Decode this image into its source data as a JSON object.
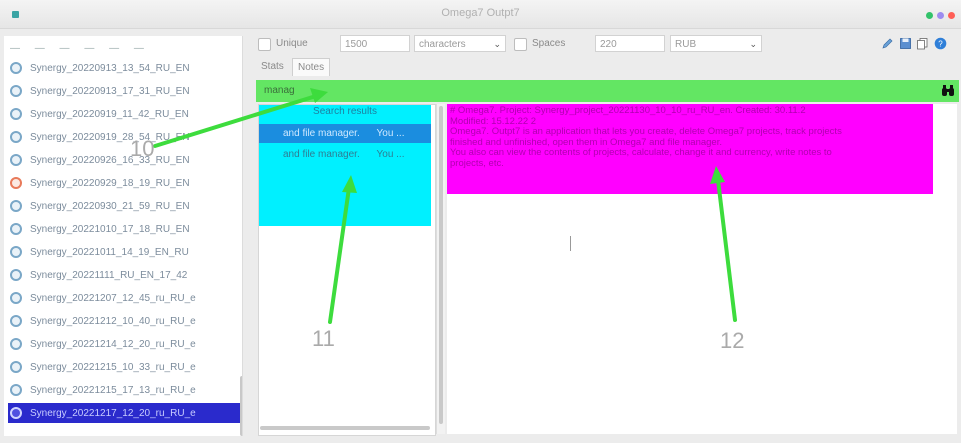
{
  "window": {
    "title": "Omega7 Outpt7",
    "colors": {
      "close": "#ff5f57",
      "minimize": "#9d8cf0",
      "zoom": "#32c26a"
    }
  },
  "sidebar": {
    "items": [
      {
        "label": "Synergy_20220913_13_54_RU_EN",
        "icon": "document-icon"
      },
      {
        "label": "Synergy_20220913_17_31_RU_EN",
        "icon": "document-icon"
      },
      {
        "label": "Synergy_20220919_11_42_RU_EN",
        "icon": "document-icon"
      },
      {
        "label": "Synergy_20220919_28_54_RU_EN",
        "icon": "document-icon"
      },
      {
        "label": "Synergy_20220926_16_33_RU_EN",
        "icon": "document-icon"
      },
      {
        "label": "Synergy_20220929_18_19_RU_EN",
        "icon": "document-red-icon"
      },
      {
        "label": "Synergy_20220930_21_59_RU_EN",
        "icon": "document-icon"
      },
      {
        "label": "Synergy_20221010_17_18_RU_EN",
        "icon": "document-icon"
      },
      {
        "label": "Synergy_20221011_14_19_EN_RU",
        "icon": "document-icon"
      },
      {
        "label": "Synergy_20221111_RU_EN_17_42",
        "icon": "document-icon"
      },
      {
        "label": "Synergy_20221207_12_45_ru_RU_e",
        "icon": "document-icon"
      },
      {
        "label": "Synergy_20221212_10_40_ru_RU_e",
        "icon": "document-icon"
      },
      {
        "label": "Synergy_20221214_12_20_ru_RU_e",
        "icon": "document-icon"
      },
      {
        "label": "Synergy_20221215_10_33_ru_RU_e",
        "icon": "document-icon"
      },
      {
        "label": "Synergy_20221215_17_13_ru_RU_e",
        "icon": "document-icon"
      },
      {
        "label": "Synergy_20221217_12_20_ru_RU_e",
        "icon": "document-icon",
        "selected": true
      }
    ]
  },
  "toolbar": {
    "unique_label": "Unique",
    "unique_value": "1500",
    "unit_select": "characters",
    "spaces_label": "Spaces",
    "spaces_value": "220",
    "currency_select": "RUB"
  },
  "tabs": [
    {
      "label": "Stats"
    },
    {
      "label": "Notes",
      "active": true
    }
  ],
  "search": {
    "query": "manag"
  },
  "results": {
    "header": "Search results",
    "rows": [
      {
        "left": "and file manager.",
        "right": "You ...",
        "selected": true
      },
      {
        "left": "and file manager.",
        "right": "You ...",
        "selected": false
      }
    ]
  },
  "detail": {
    "lines": [
      "# Omega7. Project: Synergy_project_20221130_10_10_ru_RU_en. Created: 30.11.2",
      "Modified: 15.12.22 2",
      "Omega7. Outpt7 is an application that lets you create, delete Omega7 projects, track projects",
      "finished and unfinished, open them in Omega7 and file manager.",
      "You also can view the contents of projects, calculate, change it and currency, write notes to",
      "projects, etc."
    ]
  },
  "annotations": {
    "arrow_color": "#3ddc3d",
    "labels": [
      "10",
      "11",
      "12"
    ]
  }
}
